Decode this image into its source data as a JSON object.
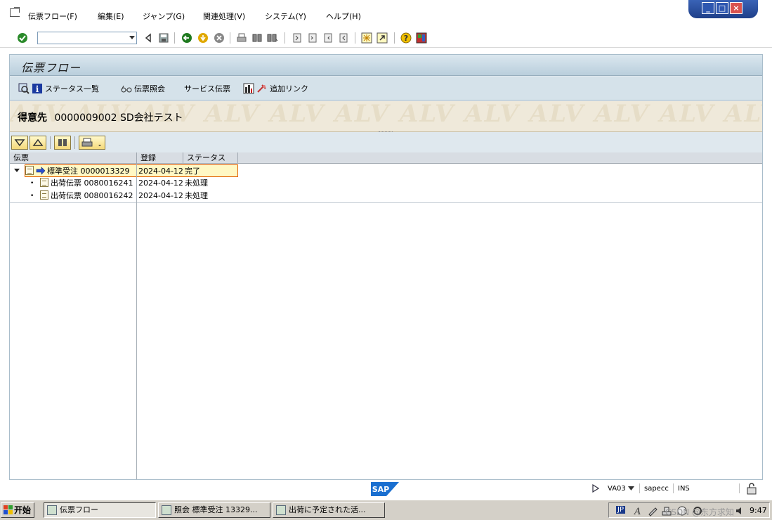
{
  "menu": {
    "items": [
      "伝票フロー(F)",
      "編集(E)",
      "ジャンプ(G)",
      "関連処理(V)",
      "システム(Y)",
      "ヘルプ(H)"
    ]
  },
  "window_controls": [
    "_",
    "□",
    "×"
  ],
  "toolbar": {
    "command_value": "",
    "icons": [
      "enter-icon",
      "back-nav-icon",
      "save-icon",
      "back-icon",
      "exit-icon",
      "cancel-icon",
      "print-icon",
      "find-icon",
      "find-next-icon",
      "first-page-icon",
      "prev-page-icon",
      "next-page-icon",
      "last-page-icon",
      "new-session-icon",
      "shortcut-icon",
      "help-icon",
      "layout-icon"
    ]
  },
  "screen": {
    "title": "伝票フロー",
    "app_buttons": [
      "ステータス一覧",
      "伝票照会",
      "サービス伝票",
      "追加リンク"
    ],
    "customer_label": "得意先",
    "customer_value": "0000009002 SD会社テスト",
    "watermark": "ALV ALV ALV ALV ALV ALV ALV ALV ALV ALV ALV ALV ALV ALV"
  },
  "table": {
    "headers": [
      "伝票",
      "登録",
      "ステータス"
    ],
    "rows": [
      {
        "doc": "標準受注 0000013329",
        "date": "2024-04-12",
        "status": "完了"
      },
      {
        "doc": "出荷伝票 0080016241",
        "date": "2024-04-12",
        "status": "未処理"
      },
      {
        "doc": "出荷伝票 0080016242",
        "date": "2024-04-12",
        "status": "未処理"
      }
    ]
  },
  "statusbar": {
    "logo": "SAP",
    "transaction": "VA03",
    "system": "sapecc",
    "mode": "INS"
  },
  "taskbar": {
    "start": "开始",
    "tasks": [
      "伝票フロー",
      "照会 標準受注 13329...",
      "出荷に予定された活..."
    ],
    "tray_lang": "JP",
    "clock": "9:47",
    "watermark": "CSDN @东方求知"
  },
  "colors": {
    "frame": "#dfe8ee",
    "selected_row": "#fff8c4",
    "taskbar": "#d4d0c8",
    "window_controls": "#2e57b0"
  }
}
